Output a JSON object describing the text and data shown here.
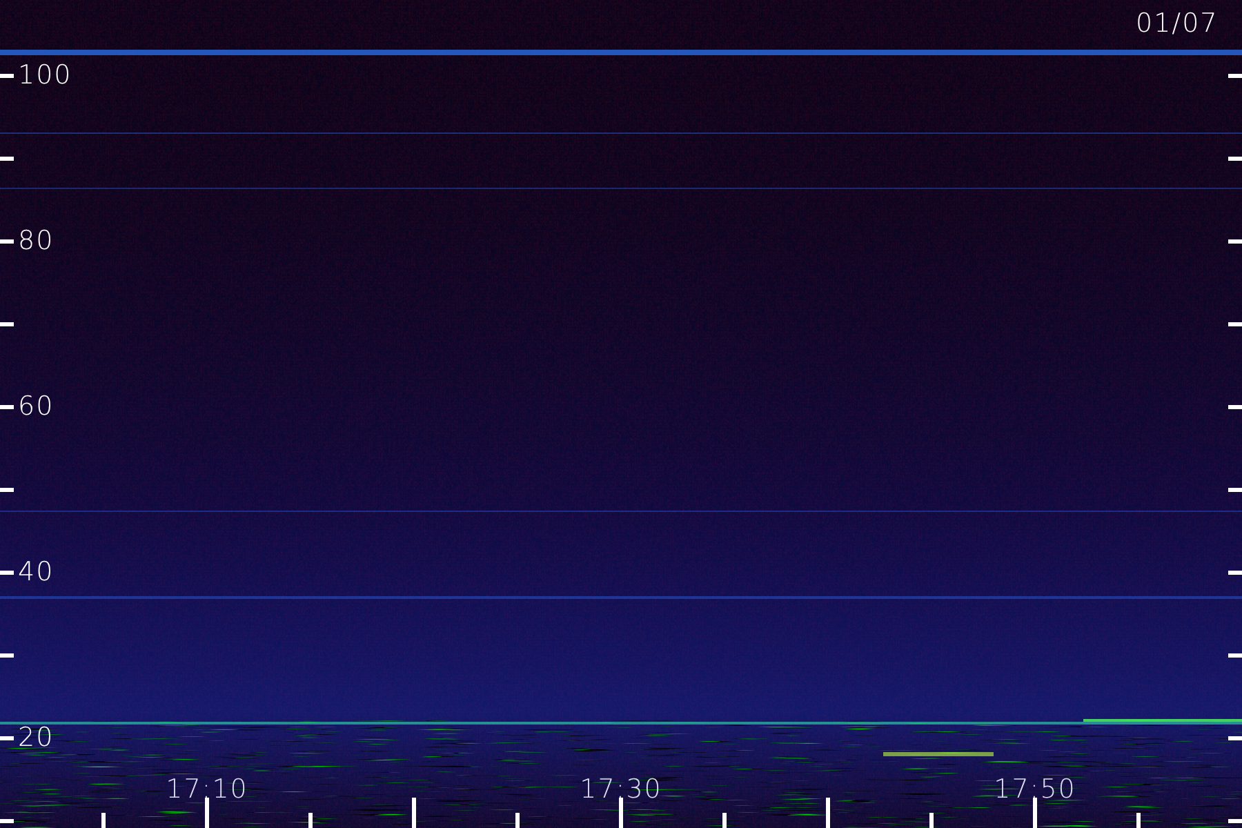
{
  "date": "01/07",
  "y_axis": {
    "labels": [
      "100",
      "80",
      "60",
      "40",
      "20"
    ]
  },
  "x_axis": {
    "labels": [
      "17:10",
      "17:30",
      "17:50"
    ]
  }
}
